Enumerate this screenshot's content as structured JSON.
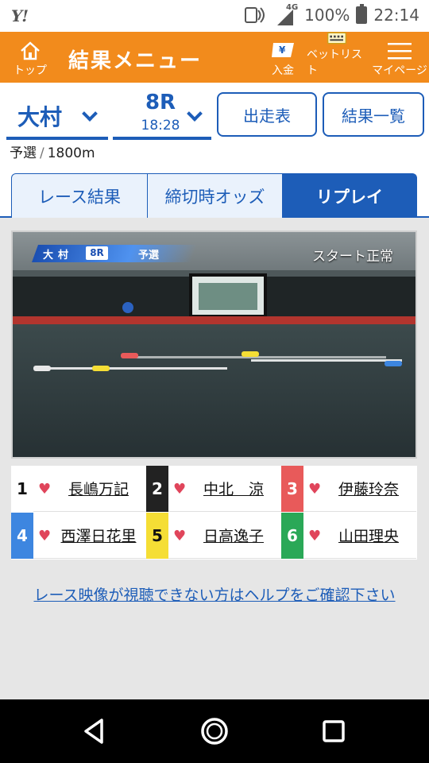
{
  "status_bar": {
    "logo": "Y!",
    "network": "4G",
    "battery": "100%",
    "time": "22:14"
  },
  "header": {
    "home_label": "トップ",
    "title": "結果メニュー",
    "deposit_label": "入金",
    "betlist_label": "ベットリスト",
    "mypage_label": "マイページ",
    "bg_color": "#f28b1c"
  },
  "selectors": {
    "venue": "大村",
    "race_number": "8R",
    "race_time": "18:28",
    "entry_button": "出走表",
    "results_button": "結果一覧"
  },
  "race_condition": {
    "class": "予選",
    "separator": "/",
    "distance": "1800m"
  },
  "tabs": [
    {
      "label": "レース結果",
      "active": false
    },
    {
      "label": "締切時オッズ",
      "active": false
    },
    {
      "label": "リプレイ",
      "active": true
    }
  ],
  "video": {
    "banner_venue": "大村",
    "banner_race": "8R",
    "banner_class": "予選",
    "status_text": "スタート正常"
  },
  "racers": [
    {
      "lane": "1",
      "name": "長嶋万記",
      "lane_color": "#ffffff",
      "text_color": "#111111"
    },
    {
      "lane": "2",
      "name": "中北　涼",
      "lane_color": "#222222",
      "text_color": "#ffffff"
    },
    {
      "lane": "3",
      "name": "伊藤玲奈",
      "lane_color": "#e85a5a",
      "text_color": "#ffffff"
    },
    {
      "lane": "4",
      "name": "西澤日花里",
      "lane_color": "#3d86e0",
      "text_color": "#ffffff"
    },
    {
      "lane": "5",
      "name": "日高逸子",
      "lane_color": "#f5de35",
      "text_color": "#111111"
    },
    {
      "lane": "6",
      "name": "山田理央",
      "lane_color": "#2aa857",
      "text_color": "#ffffff"
    }
  ],
  "help_link": "レース映像が視聴できない方はヘルプをご確認下さい",
  "accent_color": "#1d5db8"
}
